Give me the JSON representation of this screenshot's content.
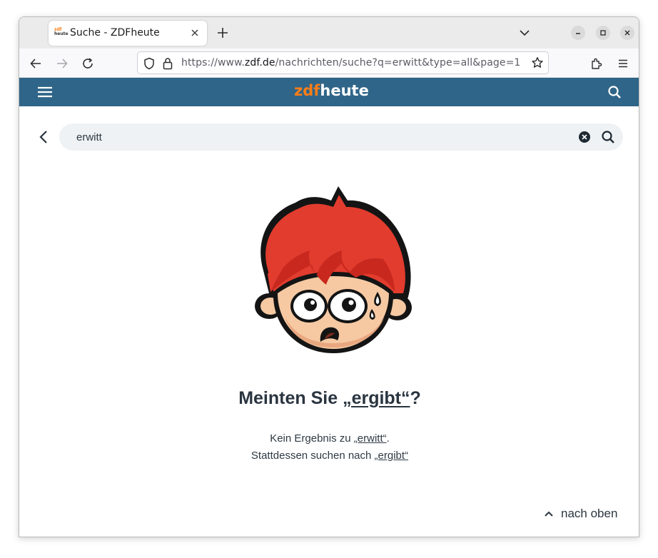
{
  "browser": {
    "tab_title": "Suche - ZDFheute",
    "favicon_text_top": "zdf",
    "favicon_text_bottom": "heute",
    "url_prefix": "https://www.",
    "url_host": "zdf.de",
    "url_path": "/nachrichten/suche?q=erwitt&type=all&page=1"
  },
  "site": {
    "logo_part1": "zdf",
    "logo_part2": "heute",
    "brand_color": "#2f6588",
    "accent_color": "#fa7d19"
  },
  "search": {
    "value": "erwitt"
  },
  "result": {
    "title_prefix": "Meinten Sie ",
    "title_suggestion": "„ergibt“",
    "title_suffix": "?",
    "line1_prefix": "Kein Ergebnis zu ",
    "line1_query": "„erwitt“",
    "line1_suffix": ".",
    "line2_prefix": "Stattdessen suchen nach ",
    "line2_suggestion": "„ergibt“"
  },
  "footer": {
    "to_top_label": "nach oben"
  },
  "icons": [
    "tab-favicon",
    "close-icon",
    "plus-icon",
    "chevron-down-icon",
    "minimize-icon",
    "maximize-icon",
    "close-icon",
    "back-arrow-icon",
    "forward-arrow-icon",
    "reload-icon",
    "shield-icon",
    "lock-icon",
    "star-icon",
    "extensions-icon",
    "menu-icon",
    "hamburger-icon",
    "search-icon",
    "clear-icon",
    "chevron-up-icon"
  ]
}
